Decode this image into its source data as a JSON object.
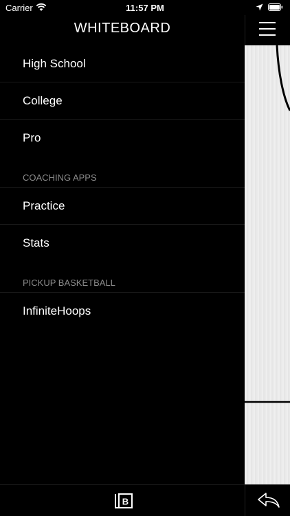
{
  "status_bar": {
    "carrier": "Carrier",
    "time": "11:57 PM"
  },
  "menu": {
    "title": "WHITEBOARD",
    "items": [
      {
        "label": "High School"
      },
      {
        "label": "College"
      },
      {
        "label": "Pro"
      }
    ],
    "sections": [
      {
        "header": "COACHING APPS",
        "items": [
          {
            "label": "Practice"
          },
          {
            "label": "Stats"
          }
        ]
      },
      {
        "header": "PICKUP BASKETBALL",
        "items": [
          {
            "label": "InfiniteHoops"
          }
        ]
      }
    ]
  },
  "icons": {
    "hamburger": "hamburger-menu-icon",
    "bottom_logo": "b-logo-icon",
    "back": "back-arrow-icon"
  },
  "colors": {
    "background": "#000000",
    "text": "#ffffff",
    "section_header": "#8a8a8a",
    "court": "#ececec"
  }
}
